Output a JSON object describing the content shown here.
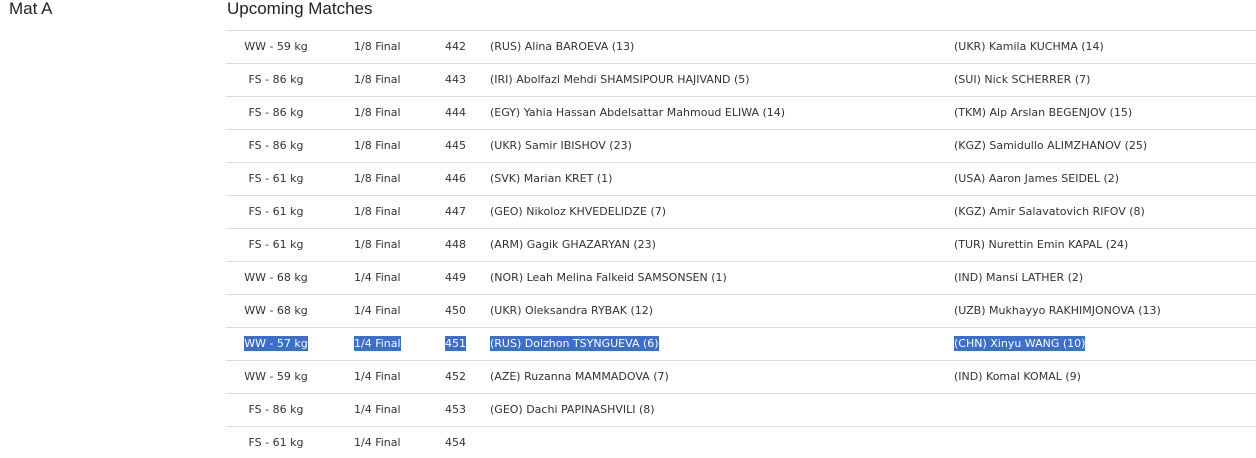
{
  "mat": {
    "label": "Mat A"
  },
  "section": {
    "title": "Upcoming Matches"
  },
  "matches": [
    {
      "weight": "WW - 59 kg",
      "round": "1/8 Final",
      "number": "442",
      "red": "(RUS) Alina BAROEVA (13)",
      "blue": "(UKR) Kamila KUCHMA (14)"
    },
    {
      "weight": "FS - 86 kg",
      "round": "1/8 Final",
      "number": "443",
      "red": "(IRI) Abolfazl Mehdi SHAMSIPOUR HAJIVAND (5)",
      "blue": "(SUI) Nick SCHERRER (7)"
    },
    {
      "weight": "FS - 86 kg",
      "round": "1/8 Final",
      "number": "444",
      "red": "(EGY) Yahia Hassan Abdelsattar Mahmoud ELIWA (14)",
      "blue": "(TKM) Alp Arslan BEGENJOV (15)"
    },
    {
      "weight": "FS - 86 kg",
      "round": "1/8 Final",
      "number": "445",
      "red": "(UKR) Samir IBISHOV (23)",
      "blue": "(KGZ) Samidullo ALIMZHANOV (25)"
    },
    {
      "weight": "FS - 61 kg",
      "round": "1/8 Final",
      "number": "446",
      "red": "(SVK) Marian KRET (1)",
      "blue": "(USA) Aaron James SEIDEL (2)"
    },
    {
      "weight": "FS - 61 kg",
      "round": "1/8 Final",
      "number": "447",
      "red": "(GEO) Nikoloz KHVEDELIDZE (7)",
      "blue": "(KGZ) Amir Salavatovich RIFOV (8)"
    },
    {
      "weight": "FS - 61 kg",
      "round": "1/8 Final",
      "number": "448",
      "red": "(ARM) Gagik GHAZARYAN (23)",
      "blue": "(TUR) Nurettin Emin KAPAL (24)"
    },
    {
      "weight": "WW - 68 kg",
      "round": "1/4 Final",
      "number": "449",
      "red": "(NOR) Leah Melina Falkeid SAMSONSEN (1)",
      "blue": "(IND) Mansi LATHER (2)"
    },
    {
      "weight": "WW - 68 kg",
      "round": "1/4 Final",
      "number": "450",
      "red": "(UKR) Oleksandra RYBAK (12)",
      "blue": "(UZB) Mukhayyo RAKHIMJONOVA (13)"
    },
    {
      "weight": "WW - 57 kg",
      "round": "1/4 Final",
      "number": "451",
      "red": "(RUS) Dolzhon TSYNGUEVA (6)",
      "blue": "(CHN) Xinyu WANG (10)",
      "selected": true
    },
    {
      "weight": "WW - 59 kg",
      "round": "1/4 Final",
      "number": "452",
      "red": "(AZE) Ruzanna MAMMADOVA (7)",
      "blue": "(IND) Komal KOMAL (9)"
    },
    {
      "weight": "FS - 86 kg",
      "round": "1/4 Final",
      "number": "453",
      "red": "(GEO) Dachi PAPINASHVILI (8)",
      "blue": ""
    },
    {
      "weight": "FS - 61 kg",
      "round": "1/4 Final",
      "number": "454",
      "red": "",
      "blue": ""
    }
  ],
  "colors": {
    "selection": "#3a6fd0",
    "divider": "#dddddd"
  }
}
